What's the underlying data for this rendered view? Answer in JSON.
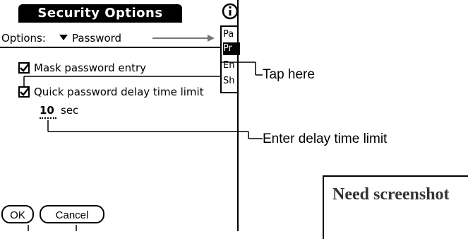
{
  "dialog": {
    "title": "Security Options",
    "options_label": "Options:",
    "options_value": "Password"
  },
  "popup": {
    "items": [
      "Pa",
      "Pr",
      "En",
      "Sh"
    ]
  },
  "settings": {
    "mask_label": "Mask password entry",
    "mask_checked": true,
    "quick_label": "Quick password delay time limit",
    "quick_checked": true,
    "delay_value": "10",
    "delay_unit": "sec"
  },
  "buttons": {
    "ok": "OK",
    "cancel": "Cancel"
  },
  "callouts": {
    "tap_here": "Tap here",
    "enter_delay": "Enter delay time limit"
  },
  "placeholder": {
    "text": "Need screenshot"
  }
}
